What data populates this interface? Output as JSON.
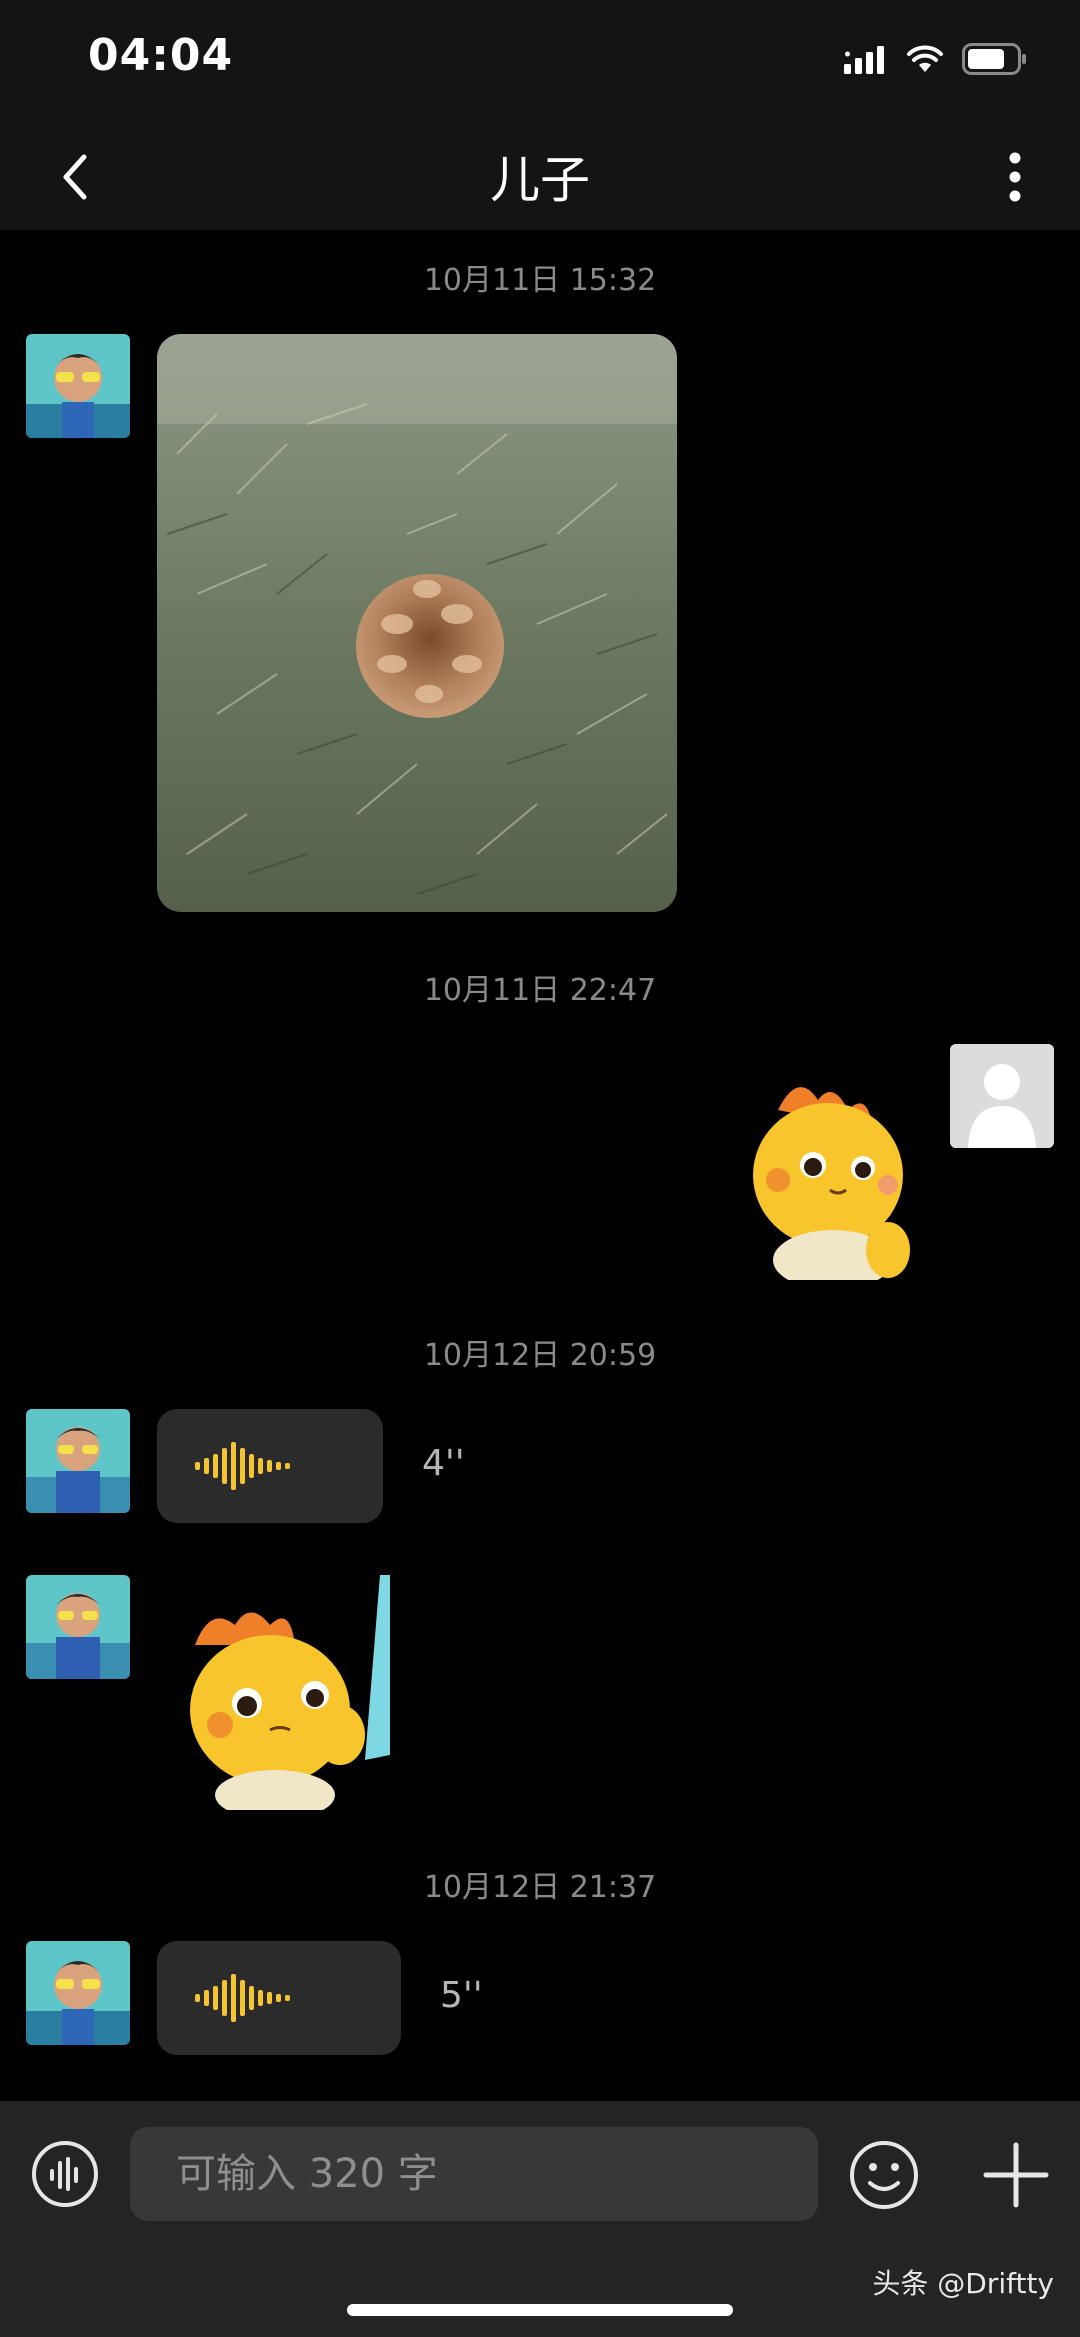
{
  "status_bar": {
    "time": "04:04"
  },
  "header": {
    "title": "儿子"
  },
  "messages": {
    "ts1": "10月11日 15:32",
    "ts2": "10月11日 22:47",
    "ts3": "10月12日 20:59",
    "ts4": "10月12日 21:37",
    "voice1_duration": "4''",
    "voice2_duration": "5''"
  },
  "input": {
    "placeholder": "可输入 320 字"
  },
  "watermark": "头条 @Driftty",
  "colors": {
    "accent": "#f5c431",
    "background": "#000000",
    "bar": "#141414",
    "input_bar": "#242424",
    "bubble": "#2b2b2b"
  }
}
